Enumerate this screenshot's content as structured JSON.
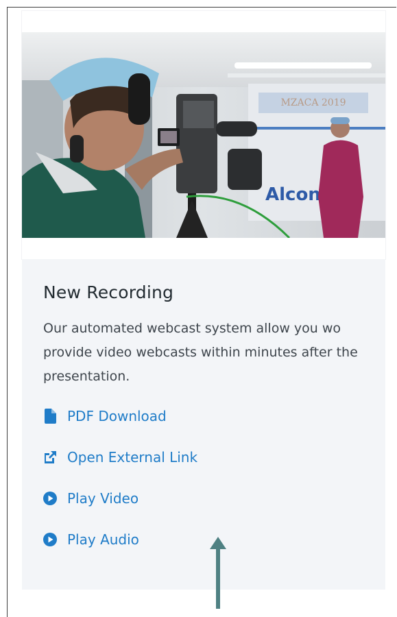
{
  "card": {
    "title": "New Recording",
    "description": "Our automated webcast system allow you wo provide video webcasts within minutes after the presentation."
  },
  "photo": {
    "wall_text": "Alcon",
    "banner_text": "MZACA 2019"
  },
  "links": [
    {
      "label": "PDF Download",
      "icon": "file-icon"
    },
    {
      "label": "Open External Link",
      "icon": "external-link-icon"
    },
    {
      "label": "Play Video",
      "icon": "play-circle-icon"
    },
    {
      "label": "Play Audio",
      "icon": "play-circle-icon"
    }
  ],
  "colors": {
    "link": "#1f7cc8",
    "card_background": "#f3f5f8",
    "arrow": "#4f8183"
  }
}
